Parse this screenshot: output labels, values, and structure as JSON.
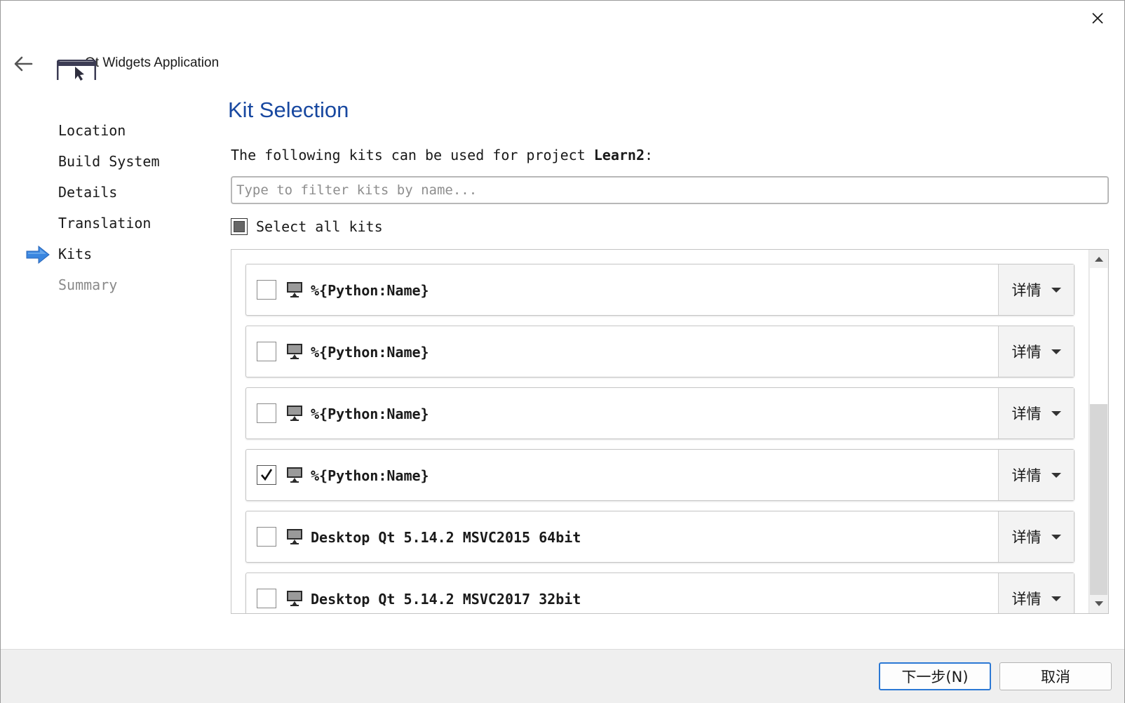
{
  "window": {
    "title": "Qt Widgets Application"
  },
  "sidebar": {
    "steps": [
      {
        "label": "Location",
        "state": "done"
      },
      {
        "label": "Build System",
        "state": "done"
      },
      {
        "label": "Details",
        "state": "done"
      },
      {
        "label": "Translation",
        "state": "done"
      },
      {
        "label": "Kits",
        "state": "current"
      },
      {
        "label": "Summary",
        "state": "pending"
      }
    ]
  },
  "main": {
    "title": "Kit Selection",
    "intro_prefix": "The following kits can be used for project ",
    "project_name": "Learn2",
    "intro_suffix": ":",
    "filter": {
      "value": "",
      "placeholder": "Type to filter kits by name..."
    },
    "select_all": {
      "label": "Select all kits",
      "state": "partial"
    },
    "kits": [
      {
        "name": "%{Python:Name}",
        "checked": false,
        "details_label": "详情"
      },
      {
        "name": "%{Python:Name}",
        "checked": false,
        "details_label": "详情"
      },
      {
        "name": "%{Python:Name}",
        "checked": false,
        "details_label": "详情"
      },
      {
        "name": "%{Python:Name}",
        "checked": true,
        "details_label": "详情"
      },
      {
        "name": "Desktop Qt 5.14.2 MSVC2015 64bit",
        "checked": false,
        "details_label": "详情"
      },
      {
        "name": "Desktop Qt 5.14.2 MSVC2017 32bit",
        "checked": false,
        "details_label": "详情"
      }
    ]
  },
  "footer": {
    "next_label": "下一步(N)",
    "cancel_label": "取消"
  },
  "colors": {
    "title_blue": "#1848a0",
    "accent_blue": "#2b78d4",
    "step_arrow": "#3a86e0"
  },
  "icons": {
    "close": "close-icon",
    "back": "back-arrow-icon",
    "app": "qt-widgets-app-icon",
    "current_step": "current-step-arrow-icon",
    "kit": "desktop-monitor-icon",
    "details": "chevron-down-icon"
  }
}
